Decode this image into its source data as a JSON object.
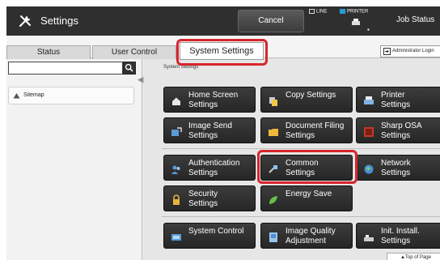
{
  "topbar": {
    "title": "Settings",
    "cancel_label": "Cancel",
    "line_label": "LINE",
    "printer_label": "PRINTER",
    "dots": "▪",
    "job_status_label": "Job Status"
  },
  "tabs": [
    {
      "label": "Status"
    },
    {
      "label": "User Control"
    },
    {
      "label": "System Settings"
    }
  ],
  "admin_login_label": "Administrator Login",
  "sidebar": {
    "search_placeholder": "",
    "collapse_glyph": "◀|",
    "sitemap_label": "Sitemap"
  },
  "main": {
    "breadcrumb": "System Settings",
    "buttons": [
      {
        "line1": "Home Screen",
        "line2": "Settings",
        "icon": "home-icon"
      },
      {
        "line1": "Copy Settings",
        "line2": "",
        "icon": "copy-icon"
      },
      {
        "line1": "Printer",
        "line2": "Settings",
        "icon": "printer-icon"
      },
      {
        "line1": "Image Send",
        "line2": "Settings",
        "icon": "image-send-icon"
      },
      {
        "line1": "Document Filing",
        "line2": "Settings",
        "icon": "folder-icon"
      },
      {
        "line1": "Sharp OSA",
        "line2": "Settings",
        "icon": "sharp-osa-icon"
      },
      {
        "line1": "Authentication",
        "line2": "Settings",
        "icon": "users-icon"
      },
      {
        "line1": "Common",
        "line2": "Settings",
        "icon": "common-settings-icon"
      },
      {
        "line1": "Network",
        "line2": "Settings",
        "icon": "globe-icon"
      },
      {
        "line1": "Security",
        "line2": "Settings",
        "icon": "lock-icon"
      },
      {
        "line1": "Energy Save",
        "line2": "",
        "icon": "leaf-icon"
      },
      {
        "line1": "System Control",
        "line2": "",
        "icon": "system-control-icon"
      },
      {
        "line1": "Image Quality",
        "line2": "Adjustment",
        "icon": "image-quality-icon"
      },
      {
        "line1": "Init. Install.",
        "line2": "Settings",
        "icon": "init-install-icon"
      }
    ],
    "top_of_page_label": "▲Top of Page"
  },
  "colors": {
    "highlight": "#d6262d",
    "topbar": "#2f2f2f",
    "button": "#2a2a2a"
  }
}
